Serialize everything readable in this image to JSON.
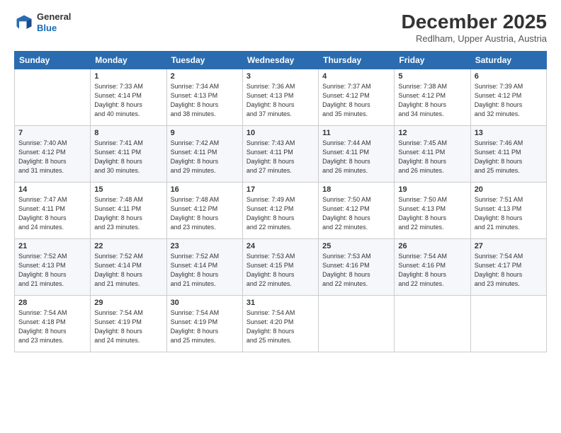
{
  "header": {
    "logo_line1": "General",
    "logo_line2": "Blue",
    "month": "December 2025",
    "location": "Redlham, Upper Austria, Austria"
  },
  "weekdays": [
    "Sunday",
    "Monday",
    "Tuesday",
    "Wednesday",
    "Thursday",
    "Friday",
    "Saturday"
  ],
  "weeks": [
    [
      {
        "day": "",
        "text": ""
      },
      {
        "day": "1",
        "text": "Sunrise: 7:33 AM\nSunset: 4:14 PM\nDaylight: 8 hours\nand 40 minutes."
      },
      {
        "day": "2",
        "text": "Sunrise: 7:34 AM\nSunset: 4:13 PM\nDaylight: 8 hours\nand 38 minutes."
      },
      {
        "day": "3",
        "text": "Sunrise: 7:36 AM\nSunset: 4:13 PM\nDaylight: 8 hours\nand 37 minutes."
      },
      {
        "day": "4",
        "text": "Sunrise: 7:37 AM\nSunset: 4:12 PM\nDaylight: 8 hours\nand 35 minutes."
      },
      {
        "day": "5",
        "text": "Sunrise: 7:38 AM\nSunset: 4:12 PM\nDaylight: 8 hours\nand 34 minutes."
      },
      {
        "day": "6",
        "text": "Sunrise: 7:39 AM\nSunset: 4:12 PM\nDaylight: 8 hours\nand 32 minutes."
      }
    ],
    [
      {
        "day": "7",
        "text": "Sunrise: 7:40 AM\nSunset: 4:12 PM\nDaylight: 8 hours\nand 31 minutes."
      },
      {
        "day": "8",
        "text": "Sunrise: 7:41 AM\nSunset: 4:11 PM\nDaylight: 8 hours\nand 30 minutes."
      },
      {
        "day": "9",
        "text": "Sunrise: 7:42 AM\nSunset: 4:11 PM\nDaylight: 8 hours\nand 29 minutes."
      },
      {
        "day": "10",
        "text": "Sunrise: 7:43 AM\nSunset: 4:11 PM\nDaylight: 8 hours\nand 27 minutes."
      },
      {
        "day": "11",
        "text": "Sunrise: 7:44 AM\nSunset: 4:11 PM\nDaylight: 8 hours\nand 26 minutes."
      },
      {
        "day": "12",
        "text": "Sunrise: 7:45 AM\nSunset: 4:11 PM\nDaylight: 8 hours\nand 26 minutes."
      },
      {
        "day": "13",
        "text": "Sunrise: 7:46 AM\nSunset: 4:11 PM\nDaylight: 8 hours\nand 25 minutes."
      }
    ],
    [
      {
        "day": "14",
        "text": "Sunrise: 7:47 AM\nSunset: 4:11 PM\nDaylight: 8 hours\nand 24 minutes."
      },
      {
        "day": "15",
        "text": "Sunrise: 7:48 AM\nSunset: 4:11 PM\nDaylight: 8 hours\nand 23 minutes."
      },
      {
        "day": "16",
        "text": "Sunrise: 7:48 AM\nSunset: 4:12 PM\nDaylight: 8 hours\nand 23 minutes."
      },
      {
        "day": "17",
        "text": "Sunrise: 7:49 AM\nSunset: 4:12 PM\nDaylight: 8 hours\nand 22 minutes."
      },
      {
        "day": "18",
        "text": "Sunrise: 7:50 AM\nSunset: 4:12 PM\nDaylight: 8 hours\nand 22 minutes."
      },
      {
        "day": "19",
        "text": "Sunrise: 7:50 AM\nSunset: 4:13 PM\nDaylight: 8 hours\nand 22 minutes."
      },
      {
        "day": "20",
        "text": "Sunrise: 7:51 AM\nSunset: 4:13 PM\nDaylight: 8 hours\nand 21 minutes."
      }
    ],
    [
      {
        "day": "21",
        "text": "Sunrise: 7:52 AM\nSunset: 4:13 PM\nDaylight: 8 hours\nand 21 minutes."
      },
      {
        "day": "22",
        "text": "Sunrise: 7:52 AM\nSunset: 4:14 PM\nDaylight: 8 hours\nand 21 minutes."
      },
      {
        "day": "23",
        "text": "Sunrise: 7:52 AM\nSunset: 4:14 PM\nDaylight: 8 hours\nand 21 minutes."
      },
      {
        "day": "24",
        "text": "Sunrise: 7:53 AM\nSunset: 4:15 PM\nDaylight: 8 hours\nand 22 minutes."
      },
      {
        "day": "25",
        "text": "Sunrise: 7:53 AM\nSunset: 4:16 PM\nDaylight: 8 hours\nand 22 minutes."
      },
      {
        "day": "26",
        "text": "Sunrise: 7:54 AM\nSunset: 4:16 PM\nDaylight: 8 hours\nand 22 minutes."
      },
      {
        "day": "27",
        "text": "Sunrise: 7:54 AM\nSunset: 4:17 PM\nDaylight: 8 hours\nand 23 minutes."
      }
    ],
    [
      {
        "day": "28",
        "text": "Sunrise: 7:54 AM\nSunset: 4:18 PM\nDaylight: 8 hours\nand 23 minutes."
      },
      {
        "day": "29",
        "text": "Sunrise: 7:54 AM\nSunset: 4:19 PM\nDaylight: 8 hours\nand 24 minutes."
      },
      {
        "day": "30",
        "text": "Sunrise: 7:54 AM\nSunset: 4:19 PM\nDaylight: 8 hours\nand 25 minutes."
      },
      {
        "day": "31",
        "text": "Sunrise: 7:54 AM\nSunset: 4:20 PM\nDaylight: 8 hours\nand 25 minutes."
      },
      {
        "day": "",
        "text": ""
      },
      {
        "day": "",
        "text": ""
      },
      {
        "day": "",
        "text": ""
      }
    ]
  ]
}
